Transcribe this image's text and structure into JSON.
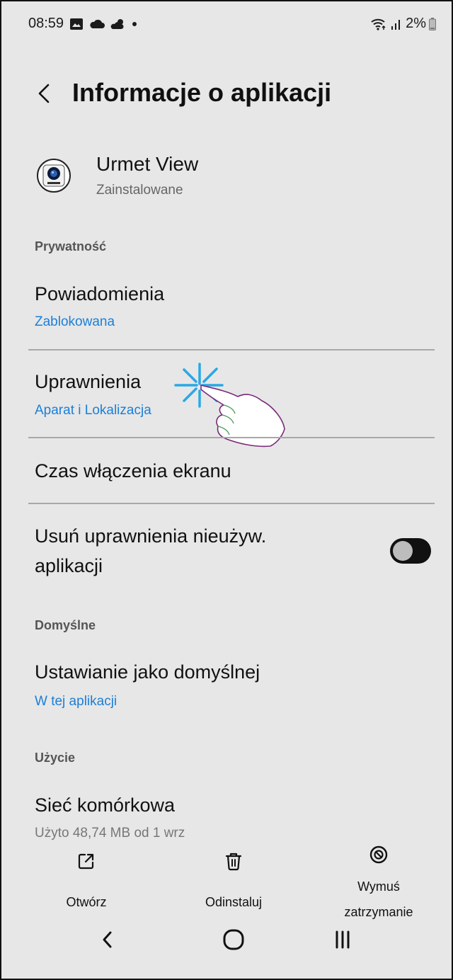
{
  "status_bar": {
    "time": "08:59",
    "battery": "2%"
  },
  "header": {
    "title": "Informacje o aplikacji"
  },
  "app": {
    "name": "Urmet View",
    "status": "Zainstalowane"
  },
  "sections": {
    "privacy": "Prywatność",
    "defaults": "Domyślne",
    "usage": "Użycie"
  },
  "items": {
    "notifications": {
      "title": "Powiadomienia",
      "subtitle": "Zablokowana"
    },
    "permissions": {
      "title": "Uprawnienia",
      "subtitle": "Aparat i Lokalizacja"
    },
    "screen_time": {
      "title": "Czas włączenia ekranu"
    },
    "remove_permissions": {
      "title_line1": "Usuń uprawnienia nieużyw.",
      "title_line2": "aplikacji",
      "toggle_on": false
    },
    "set_default": {
      "title": "Ustawianie jako domyślnej",
      "subtitle": "W tej aplikacji"
    },
    "mobile_data": {
      "title": "Sieć komórkowa",
      "subtitle": "Użyto 48,74 MB od 1 wrz"
    }
  },
  "actions": {
    "open": "Otwórz",
    "uninstall": "Odinstaluj",
    "force_stop_line1": "Wymuś",
    "force_stop_line2": "zatrzymanie"
  },
  "colors": {
    "background": "#e7e7e7",
    "link": "#1b7fd8",
    "tap_highlight": "#29a8e6",
    "hand_outline": "#7a2a7a"
  }
}
